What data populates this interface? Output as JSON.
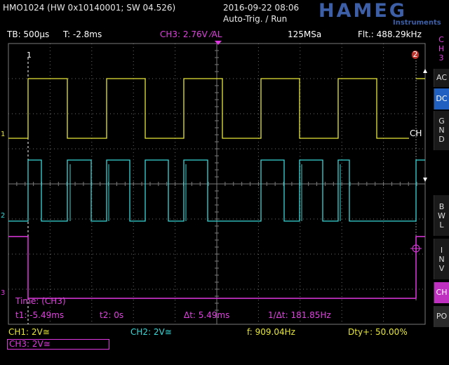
{
  "header": {
    "device": "HMO1024 (HW 0x10140001; SW 04.526)",
    "datetime": "2016-09-22 08:06",
    "trigger_mode": "Auto-Trig. / Run",
    "brand": "HAMEG",
    "brand_sub": "Instruments"
  },
  "infobar": {
    "timebase": "TB: 500µs",
    "trigger_time": "T: -2.8ms",
    "trigger_level": "CH3: 2.76V",
    "trigger_slope": "⁄AL",
    "sample_rate": "125MSa",
    "frequency_readout": "Flt.: 488.29kHz"
  },
  "side_menu": {
    "channel": [
      "C",
      "H",
      "3"
    ],
    "ac": "AC",
    "dc": "DC",
    "gnd": [
      "G",
      "N",
      "D"
    ],
    "bwl": [
      "B",
      "W",
      "L"
    ],
    "inv": [
      "I",
      "N",
      "V"
    ],
    "ch_btn": "CH",
    "po": "PO"
  },
  "markers": {
    "ch1": "1",
    "ch2": "2",
    "ch3": "3",
    "cursor1": "1",
    "cursor2": "2",
    "ch_label": "CH"
  },
  "cursor_readout": {
    "title": "Time: (CH3)",
    "t1": "t1: -5.49ms",
    "t2": "t2: 0s",
    "dt": "Δt: 5.49ms",
    "inv_dt": "1/Δt: 181.85Hz"
  },
  "footer": {
    "ch1": "CH1: 2V≅",
    "ch2": "CH2: 2V≅",
    "freq": "f: 909.04Hz",
    "duty": "Dty+: 50.00%",
    "ch3": "CH3: 2V≅"
  },
  "colors": {
    "ch1": "#e8e838",
    "ch2": "#38d8d8",
    "ch3": "#e038e0",
    "grid": "#7a7a7a",
    "active_button": "#2060c0"
  }
}
